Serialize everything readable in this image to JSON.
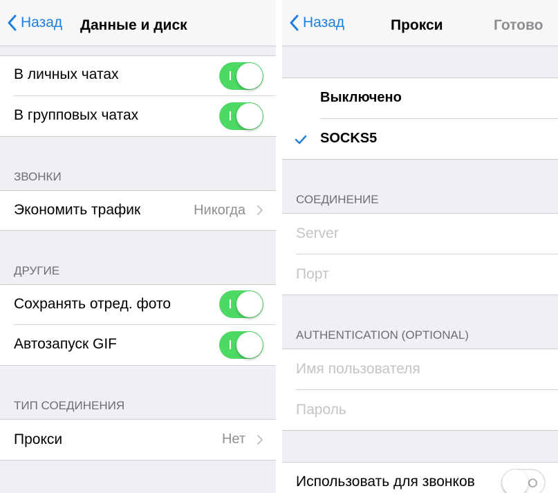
{
  "left": {
    "nav": {
      "back_label": "Назад",
      "title": "Данные и диск"
    },
    "autoload_rows": [
      {
        "label": "В личных чатах",
        "toggle": "on"
      },
      {
        "label": "В групповых чатах",
        "toggle": "on"
      }
    ],
    "calls": {
      "header": "ЗВОНКИ",
      "row": {
        "label": "Экономить трафик",
        "value": "Никогда"
      }
    },
    "other": {
      "header": "ДРУГИЕ",
      "rows": [
        {
          "label": "Сохранять отред. фото",
          "toggle": "on"
        },
        {
          "label": "Автозапуск GIF",
          "toggle": "on"
        }
      ]
    },
    "connection_type": {
      "header": "ТИП СОЕДИНЕНИЯ",
      "row": {
        "label": "Прокси",
        "value": "Нет"
      }
    }
  },
  "right": {
    "nav": {
      "back_label": "Назад",
      "title": "Прокси",
      "done_label": "Готово"
    },
    "proxy_options": [
      {
        "label": "Выключено",
        "selected": false
      },
      {
        "label": "SOCKS5",
        "selected": true
      }
    ],
    "connection": {
      "header": "СОЕДИНЕНИЕ",
      "server_placeholder": "Server",
      "port_placeholder": "Порт"
    },
    "auth": {
      "header": "AUTHENTICATION (OPTIONAL)",
      "username_placeholder": "Имя пользователя",
      "password_placeholder": "Пароль"
    },
    "calls_row": {
      "label": "Использовать для звонков",
      "toggle": "off"
    }
  },
  "colors": {
    "accent_blue": "#1d7fdc",
    "toggle_green": "#4cd964",
    "grouped_background": "#efeff4",
    "secondary_text": "#8e8e93",
    "placeholder_text": "#c4c4c8"
  },
  "icons": [
    "back-chevron-icon",
    "disclosure-chevron-icon",
    "checkmark-icon",
    "toggle-switch"
  ]
}
